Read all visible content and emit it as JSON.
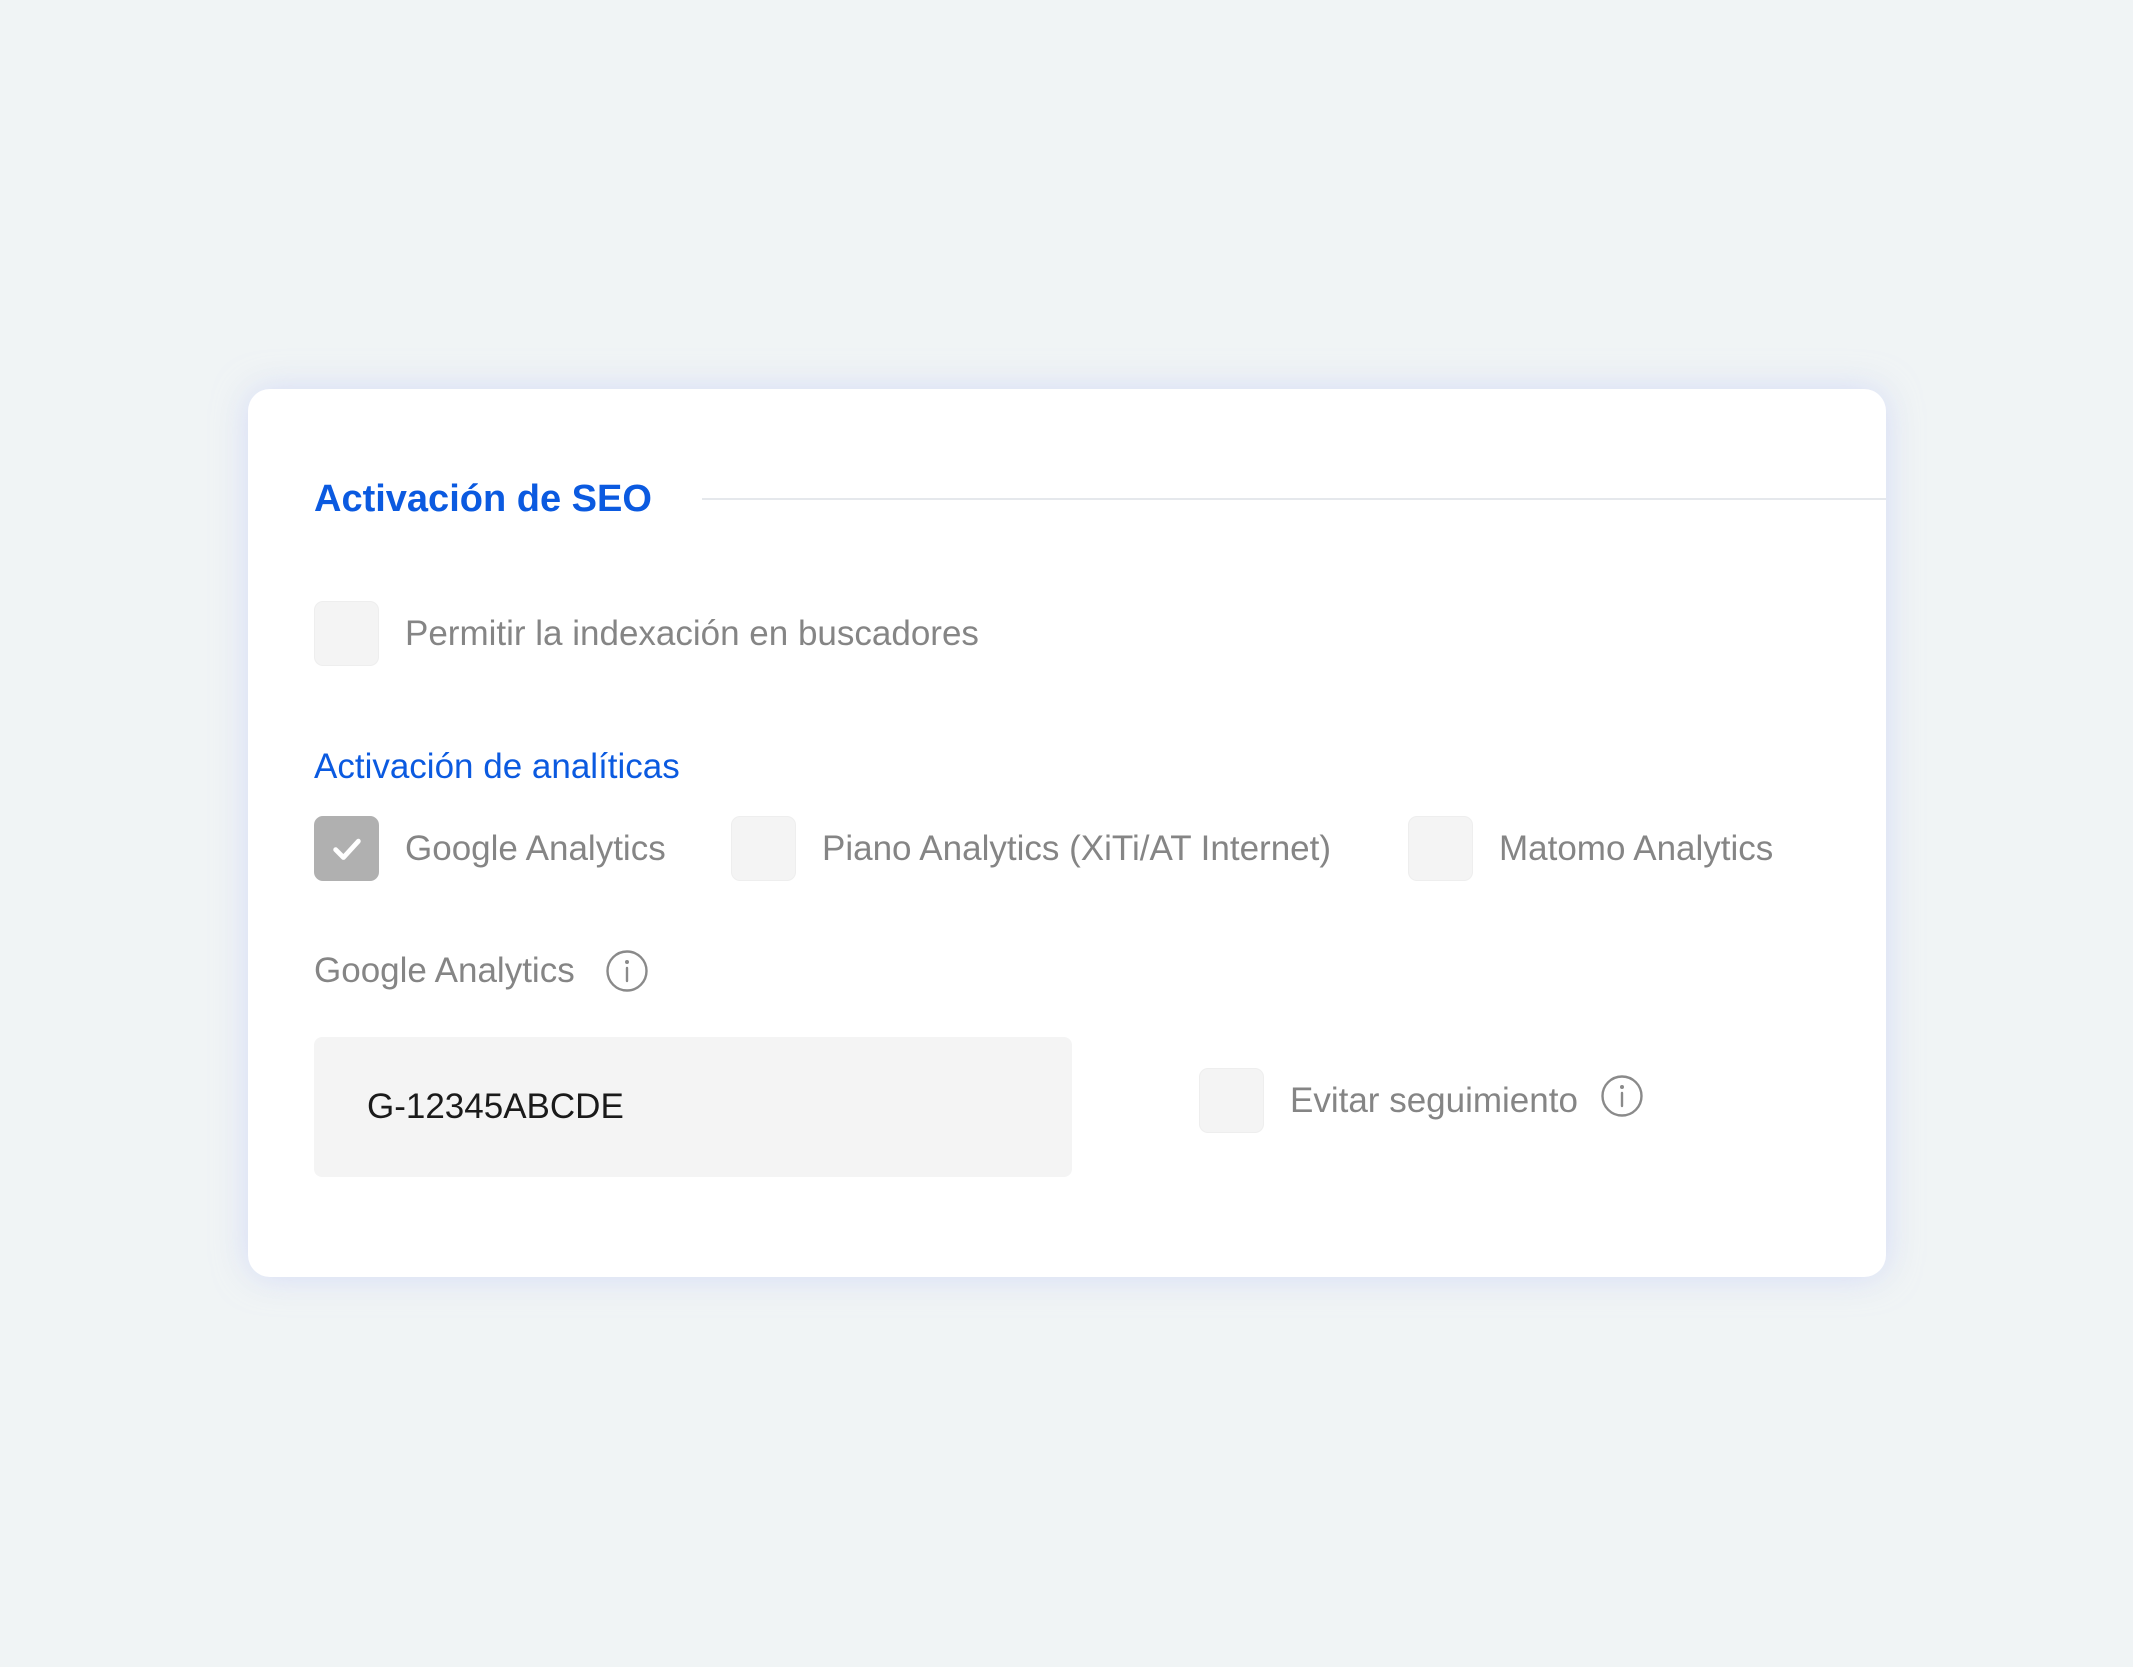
{
  "seo": {
    "title": "Activación de SEO",
    "allow_indexing": {
      "label": "Permitir la indexación en buscadores",
      "checked": false
    }
  },
  "analytics": {
    "title": "Activación de analíticas",
    "options": [
      {
        "label": "Google Analytics",
        "checked": true
      },
      {
        "label": "Piano Analytics (XiTi/AT Internet)",
        "checked": false
      },
      {
        "label": "Matomo Analytics",
        "checked": false
      }
    ]
  },
  "google_analytics": {
    "label": "Google Analytics",
    "info_icon": "info-icon",
    "value": "G-12345ABCDE",
    "avoid_tracking": {
      "label": "Evitar seguimiento",
      "checked": false,
      "info_icon": "info-icon"
    }
  },
  "colors": {
    "accent": "#0b5ae0",
    "label": "#858585",
    "checkbox_bg": "#f4f4f4",
    "checkbox_checked": "#b0b0b0",
    "page_bg": "#f0f4f5"
  }
}
